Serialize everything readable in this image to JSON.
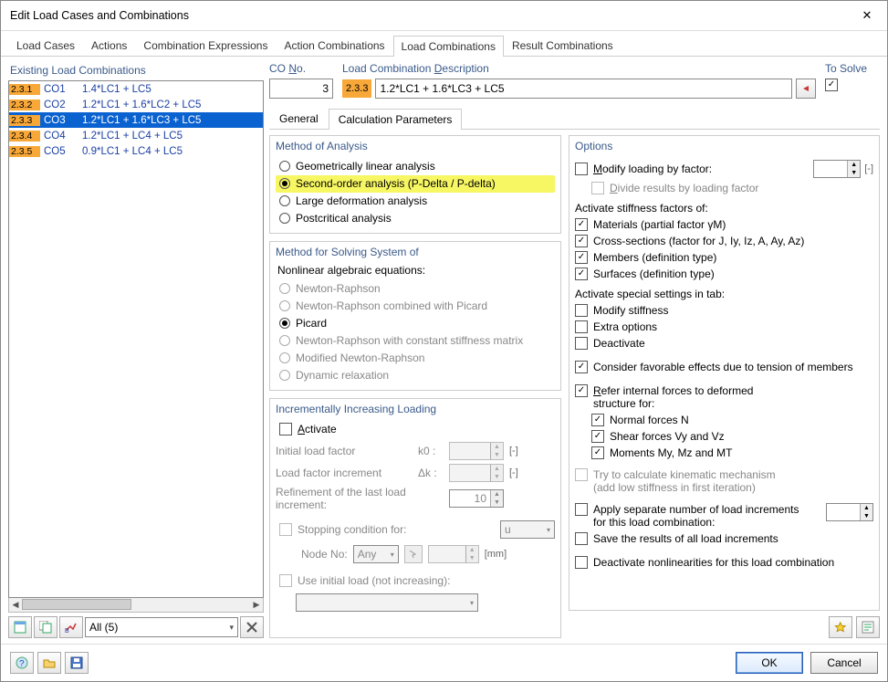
{
  "window": {
    "title": "Edit Load Cases and Combinations"
  },
  "main_tabs": [
    "Load Cases",
    "Actions",
    "Combination Expressions",
    "Action Combinations",
    "Load Combinations",
    "Result Combinations"
  ],
  "main_tabs_active": 4,
  "left": {
    "header": "Existing Load Combinations",
    "rows": [
      {
        "badge": "2.3.1",
        "co": "CO1",
        "desc": "1.4*LC1 + LC5"
      },
      {
        "badge": "2.3.2",
        "co": "CO2",
        "desc": "1.2*LC1 + 1.6*LC2 + LC5"
      },
      {
        "badge": "2.3.3",
        "co": "CO3",
        "desc": "1.2*LC1 + 1.6*LC3 + LC5",
        "sel": true
      },
      {
        "badge": "2.3.4",
        "co": "CO4",
        "desc": "1.2*LC1 + LC4 + LC5"
      },
      {
        "badge": "2.3.5",
        "co": "CO5",
        "desc": "0.9*LC1 + LC4 + LC5"
      }
    ],
    "filter": "All (5)"
  },
  "top": {
    "cono_label": "CO No.",
    "cono_value": "3",
    "lcd_label": "Load Combination Description",
    "lcd_badge": "2.3.3",
    "lcd_value": "1.2*LC1 + 1.6*LC3 + LC5",
    "tosolve_label": "To Solve",
    "tosolve": true
  },
  "sub_tabs": [
    "General",
    "Calculation Parameters"
  ],
  "sub_tabs_active": 1,
  "method_analysis": {
    "header": "Method of Analysis",
    "items": [
      {
        "label": "Geometrically linear analysis",
        "u": "G"
      },
      {
        "label": "Second-order analysis (P-Delta / P-delta)",
        "u": "S",
        "sel": true,
        "hl": true
      },
      {
        "label": "Large deformation analysis",
        "u": "L"
      },
      {
        "label": "Postcritical analysis",
        "u": "P"
      }
    ]
  },
  "method_solve": {
    "header": "Method for Solving System of",
    "subheader": "Nonlinear algebraic equations:",
    "items": [
      {
        "label": "Newton-Raphson",
        "u": "N",
        "disabled": true
      },
      {
        "label": "Newton-Raphson combined with Picard",
        "u": "R",
        "disabled": true
      },
      {
        "label": "Picard",
        "u": "i",
        "sel": true
      },
      {
        "label": "Newton-Raphson with constant stiffness matrix",
        "u": "c",
        "disabled": true
      },
      {
        "label": "Modified Newton-Raphson",
        "u": "h",
        "disabled": true
      },
      {
        "label": "Dynamic relaxation",
        "u": "D",
        "disabled": true
      }
    ]
  },
  "incr": {
    "header": "Incrementally Increasing Loading",
    "activate": "Activate",
    "rows": {
      "initial": {
        "label": "Initial load factor",
        "sym": "k0 :",
        "unit": "[-]"
      },
      "incr": {
        "label": "Load factor increment",
        "sym": "Δk :",
        "unit": "[-]"
      },
      "refine": {
        "label": "Refinement of the last load\nincrement:",
        "val": "10"
      },
      "stop": {
        "label": "Stopping condition for:",
        "val": "u"
      },
      "node": {
        "label": "Node No:",
        "combo": "Any",
        "unit": "[mm]"
      },
      "useinit": {
        "label": "Use initial load (not increasing):"
      }
    }
  },
  "options": {
    "header": "Options",
    "mod_loading": "Modify loading by factor:",
    "mod_unit": "[-]",
    "divide": "Divide results by loading factor",
    "asf_label": "Activate stiffness factors of:",
    "asf": [
      {
        "label": "Materials (partial factor γM)",
        "chk": true
      },
      {
        "label": "Cross-sections (factor for J, Iy, Iz, A, Ay, Az)",
        "chk": true
      },
      {
        "label": "Members (definition type)",
        "chk": true
      },
      {
        "label": "Surfaces (definition type)",
        "chk": true
      }
    ],
    "ass_label": "Activate special settings in tab:",
    "ass": [
      {
        "label": "Modify stiffness",
        "chk": false
      },
      {
        "label": "Extra options",
        "chk": false
      },
      {
        "label": "Deactivate",
        "chk": false
      }
    ],
    "consider": {
      "label": "Consider favorable effects due to tension of members",
      "chk": true
    },
    "refer": {
      "label": "Refer internal forces to deformed\nstructure for:",
      "chk": true
    },
    "refer_sub": [
      {
        "label": "Normal forces N",
        "chk": true
      },
      {
        "label": "Shear forces Vy and Vz",
        "chk": true
      },
      {
        "label": "Moments My, Mz and MT",
        "chk": true
      }
    ],
    "try": {
      "label": "Try to calculate kinematic mechanism\n(add low stiffness in first iteration)",
      "disabled": true
    },
    "apply_sep": {
      "label": "Apply separate number of load increments\nfor this load combination:"
    },
    "save_all": {
      "label": "Save the results of all load increments"
    },
    "deact_nl": {
      "label": "Deactivate nonlinearities for this load combination"
    }
  },
  "buttons": {
    "ok": "OK",
    "cancel": "Cancel"
  }
}
